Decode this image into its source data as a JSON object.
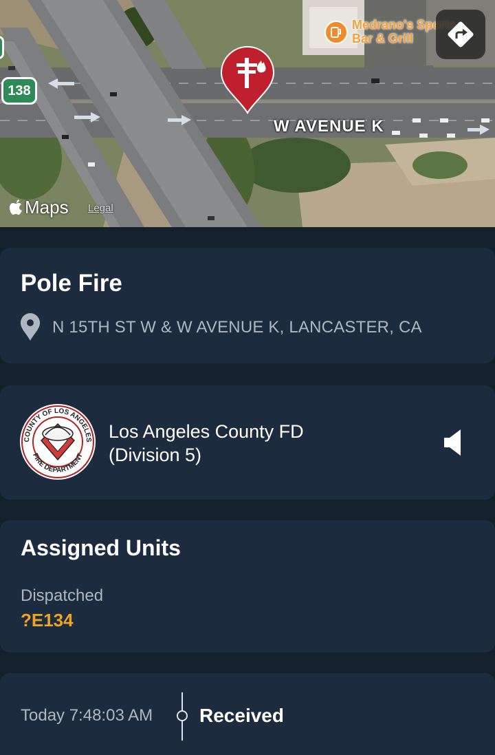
{
  "map": {
    "street_label": "W AVENUE K",
    "poi_label_line1": "Medrano's Sports",
    "poi_label_line2": "Bar & Grill",
    "route_shield": "138",
    "brand": "Maps",
    "legal": "Legal",
    "pin_icon": "pole-fire-icon",
    "directions_icon": "directions-arrow-icon"
  },
  "incident": {
    "title": "Pole Fire",
    "location": "N 15TH ST W & W AVENUE K, LANCASTER, CA",
    "location_icon": "location-pin-icon"
  },
  "agency": {
    "name_line1": "Los Angeles County FD",
    "name_line2": "(Division 5)",
    "logo_text_top": "COUNTY OF LOS ANGELES",
    "logo_text_bottom": "FIRE DEPARTMENT",
    "audio_icon": "speaker-icon"
  },
  "units": {
    "title": "Assigned Units",
    "status": "Dispatched",
    "codes": [
      "?E134"
    ]
  },
  "timeline": {
    "entries": [
      {
        "time": "Today 7:48:03 AM",
        "event": "Received"
      }
    ]
  },
  "colors": {
    "background": "#15202d",
    "card": "#1c2b3d",
    "accent_unit": "#f0a424",
    "pin": "#c0202e"
  }
}
